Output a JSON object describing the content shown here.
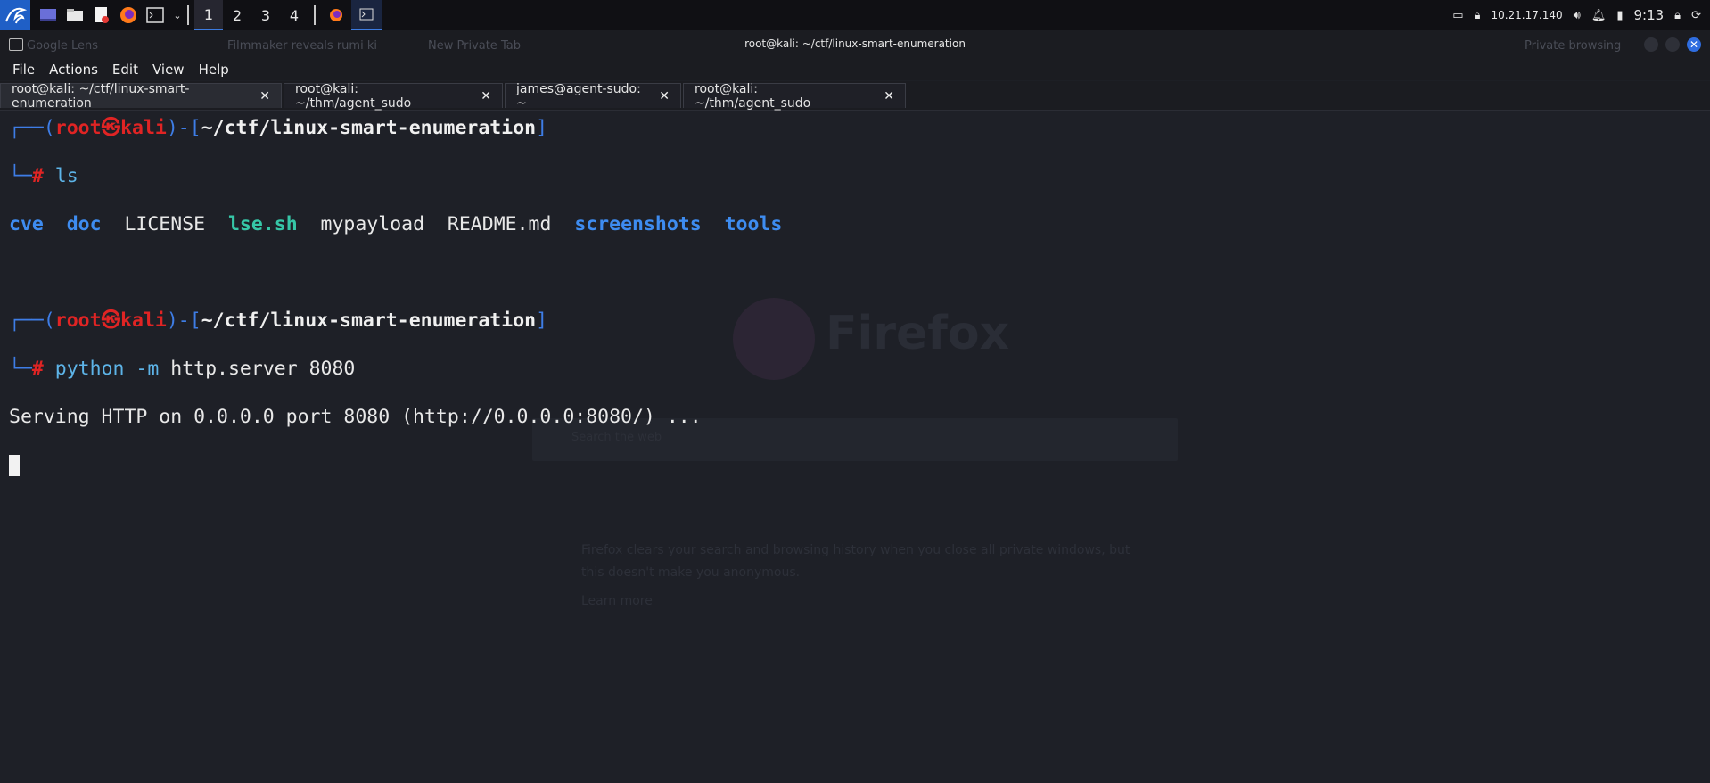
{
  "panel": {
    "workspaces": [
      "1",
      "2",
      "3",
      "4"
    ],
    "active_workspace": "1",
    "ip": "10.21.17.140",
    "clock": "9:13"
  },
  "window": {
    "title": "root@kali: ~/ctf/linux-smart-enumeration"
  },
  "menu": [
    "File",
    "Actions",
    "Edit",
    "View",
    "Help"
  ],
  "tabs": [
    {
      "label": "root@kali: ~/ctf/linux-smart-enumeration",
      "active": true
    },
    {
      "label": "root@kali: ~/thm/agent_sudo",
      "active": false
    },
    {
      "label": "james@agent-sudo: ~",
      "active": false
    },
    {
      "label": "root@kali: ~/thm/agent_sudo",
      "active": false
    }
  ],
  "terminal": {
    "prompt": {
      "open": "┌──(",
      "user": "root",
      "at": "㉿",
      "host": "kali",
      "close": ")-[",
      "path": "~/ctf/linux-smart-enumeration",
      "end": "]",
      "corner": "└─",
      "hash": "#"
    },
    "cmd1": "ls",
    "ls_output": [
      {
        "name": "cve",
        "kind": "dir"
      },
      {
        "name": "doc",
        "kind": "dir"
      },
      {
        "name": "LICENSE",
        "kind": "file"
      },
      {
        "name": "lse.sh",
        "kind": "exe"
      },
      {
        "name": "mypayload",
        "kind": "file"
      },
      {
        "name": "README.md",
        "kind": "file"
      },
      {
        "name": "screenshots",
        "kind": "dir"
      },
      {
        "name": "tools",
        "kind": "dir"
      }
    ],
    "cmd2_prog": "python",
    "cmd2_flag": "-m",
    "cmd2_args": "http.server 8080",
    "output": "Serving HTTP on 0.0.0.0 port 8080 (http://0.0.0.0:8080/) ..."
  },
  "background": {
    "ghost_tabs": [
      "Google Lens",
      "Filmmaker reveals rumi ki",
      "New Private Tab",
      "Private browsing"
    ],
    "brand": "Firefox",
    "search_placeholder": "Search the web",
    "private_note": "Firefox clears your search and browsing history when you close all private windows, but this doesn't make you anonymous.",
    "learn_more": "Learn more"
  },
  "colors": {
    "prompt_line": "#3e7de6",
    "user_host": "#e02424",
    "directory": "#3e8cf0",
    "executable": "#36c6a7",
    "command": "#5db4e8"
  }
}
